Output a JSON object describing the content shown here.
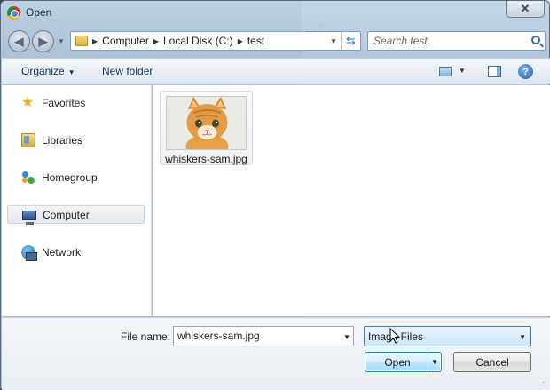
{
  "window": {
    "title": "Open",
    "close_glyph": "✕"
  },
  "nav": {
    "breadcrumbs": [
      "Computer",
      "Local Disk (C:)",
      "test"
    ],
    "search_placeholder": "Search test"
  },
  "command_bar": {
    "organize_label": "Organize",
    "new_folder_label": "New folder",
    "help_glyph": "?"
  },
  "sidebar": {
    "items": [
      {
        "label": "Favorites",
        "icon": "star-icon"
      },
      {
        "label": "Libraries",
        "icon": "libraries-icon"
      },
      {
        "label": "Homegroup",
        "icon": "homegroup-icon"
      },
      {
        "label": "Computer",
        "icon": "computer-icon",
        "selected": true
      },
      {
        "label": "Network",
        "icon": "network-icon"
      }
    ]
  },
  "files": [
    {
      "name": "whiskers-sam.jpg",
      "thumbnail": "orange-kitten-photo"
    }
  ],
  "footer": {
    "file_name_label": "File name:",
    "file_name_value": "whiskers-sam.jpg",
    "file_type_value": "Image Files",
    "open_label": "Open",
    "cancel_label": "Cancel"
  },
  "colors": {
    "accent": "#3c7fb1",
    "selected_bg": "#e4e8ee",
    "frame": "#b2c7de"
  }
}
